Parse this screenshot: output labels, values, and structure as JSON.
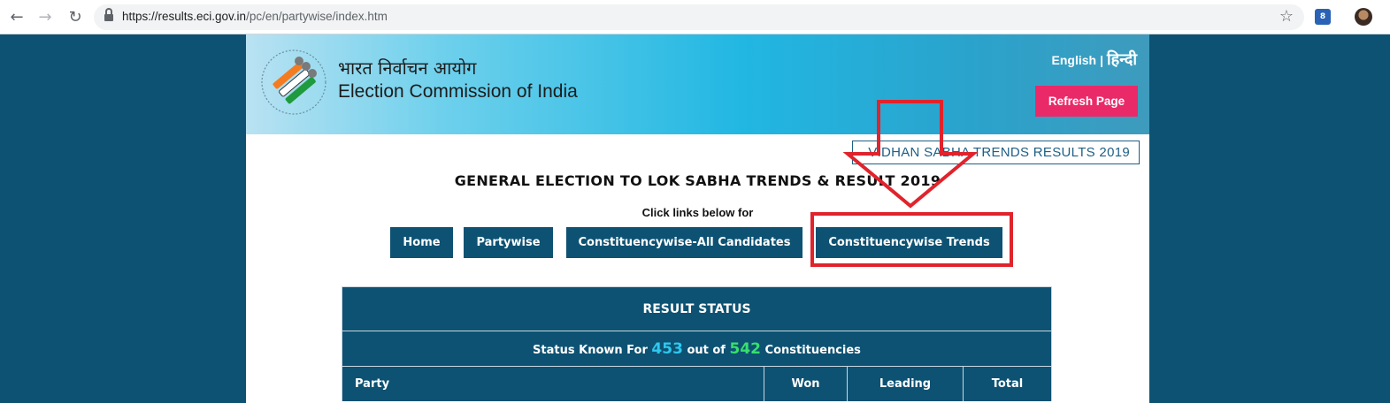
{
  "browser": {
    "url_host": "https://results.eci.gov.in",
    "url_path": "/pc/en/partywise/index.htm",
    "back_icon": "←",
    "forward_icon": "→",
    "reload_icon": "↻",
    "star_icon": "☆",
    "extension_label": "8"
  },
  "header": {
    "title_hindi": "भारत निर्वाचन आयोग",
    "title_english": "Election Commission of India",
    "lang_english": "English",
    "lang_separator": "|",
    "lang_hindi": "हिन्दी",
    "refresh_label": "Refresh Page"
  },
  "vidhan_link": "VIDHAN SABHA TRENDS RESULTS 2019",
  "heading": "GENERAL ELECTION TO LOK SABHA TRENDS & RESULT 2019",
  "click_text": "Click links below for",
  "nav": {
    "home": "Home",
    "partywise": "Partywise",
    "all_candidates": "Constituencywise-All Candidates",
    "trends": "Constituencywise Trends"
  },
  "result": {
    "title": "RESULT STATUS",
    "known_prefix": "Status Known For",
    "known_count": "453",
    "known_middle": "out of",
    "total_count": "542",
    "known_suffix": "Constituencies",
    "columns": [
      "Party",
      "Won",
      "Leading",
      "Total"
    ]
  },
  "colors": {
    "page_bg": "#0d5273",
    "accent_button": "#ea2a68",
    "annotation": "#e0232c"
  }
}
